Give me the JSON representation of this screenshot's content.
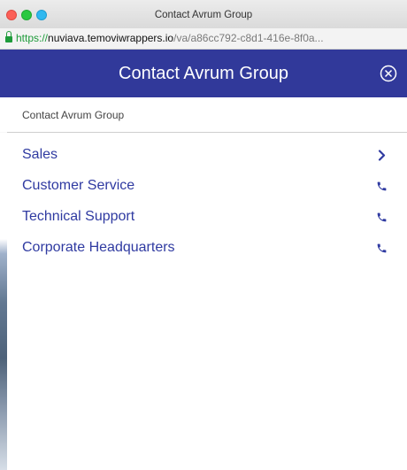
{
  "window": {
    "title": "Contact Avrum Group"
  },
  "address_bar": {
    "scheme": "https://",
    "host": "nuviava.temoviwrappers.io",
    "path": "/va/a86cc792-c8d1-416e-8f0a..."
  },
  "header": {
    "title": "Contact Avrum Group",
    "background_color": "#31399a",
    "close_icon": "close-circle-icon"
  },
  "breadcrumb": {
    "text": "Contact Avrum Group"
  },
  "menu": {
    "items": [
      {
        "label": "Sales",
        "icon": "chevron-right-icon"
      },
      {
        "label": "Customer Service",
        "icon": "phone-icon"
      },
      {
        "label": "Technical Support",
        "icon": "phone-icon"
      },
      {
        "label": "Corporate Headquarters",
        "icon": "phone-icon"
      }
    ]
  }
}
